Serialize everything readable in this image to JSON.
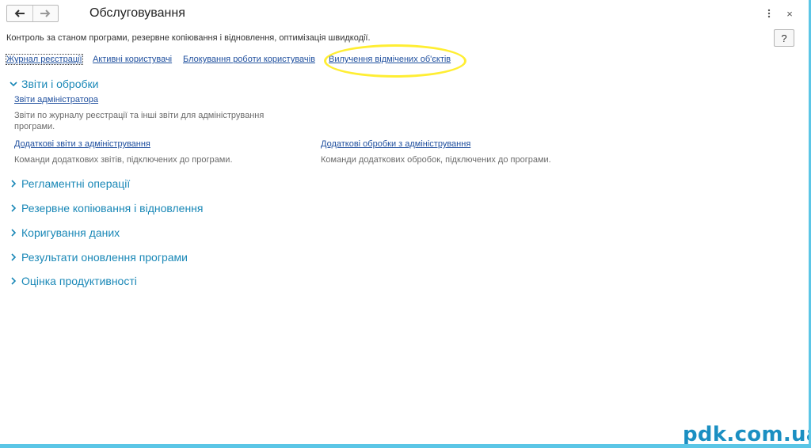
{
  "window": {
    "title": "Обслуговування",
    "help_label": "?",
    "close_label": "×"
  },
  "description": "Контроль за станом програми, резервне копіювання і відновлення, оптимізація швидкодії.",
  "links": [
    {
      "label": "Журнал реєстрації"
    },
    {
      "label": "Активні користувачі"
    },
    {
      "label": "Блокування роботи користувачів"
    },
    {
      "label": "Вилучення відмічених об'єктів"
    }
  ],
  "groups": [
    {
      "label": "Звіти і обробки",
      "expanded": true
    },
    {
      "label": "Регламентні операції",
      "expanded": false
    },
    {
      "label": "Резервне копіювання і відновлення",
      "expanded": false
    },
    {
      "label": "Коригування даних",
      "expanded": false
    },
    {
      "label": "Результати оновлення програми",
      "expanded": false
    },
    {
      "label": "Оцінка продуктивності",
      "expanded": false
    }
  ],
  "reports": {
    "admin_reports": {
      "label": "Звіти адміністратора",
      "description": "Звіти по журналу реєстрації та інші звіти для адміністрування програми."
    },
    "additional_reports": {
      "label": "Додаткові звіти з адміністрування",
      "description": "Команди додаткових звітів, підключених до програми."
    },
    "additional_processing": {
      "label": "Додаткові обробки з адміністрування",
      "description": "Команди додаткових обробок, підключених до програми."
    }
  },
  "watermark": "pdk.com.ua",
  "colors": {
    "link": "#1f4f9e",
    "group_header": "#1a88b7",
    "highlight": "#ffee33",
    "accent_bar": "#5bc6e6"
  }
}
